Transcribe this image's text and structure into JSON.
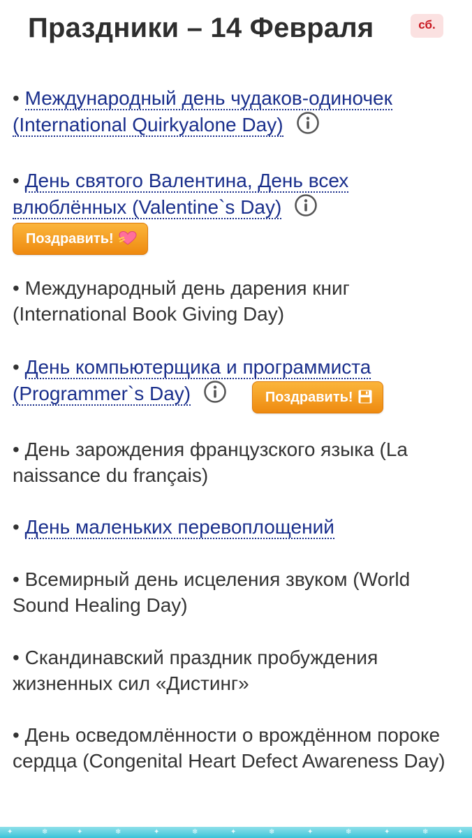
{
  "header": {
    "title": "Праздники – 14 Февраля",
    "day_badge": "сб."
  },
  "holidays": [
    {
      "bullet": "•",
      "title": "Международный день чудаков-одиночек (International Quirkyalone Day)",
      "is_link": true,
      "has_info": true,
      "button": null
    },
    {
      "bullet": "•",
      "title": "День святого Валентина, День всех влюблённых (Valentine`s Day)",
      "is_link": true,
      "has_info": true,
      "button": {
        "label": "Поздравить!",
        "icon": "heart-icon"
      }
    },
    {
      "bullet": "•",
      "title": "Международный день дарения книг (International Book Giving Day)",
      "is_link": false,
      "has_info": false,
      "button": null
    },
    {
      "bullet": "•",
      "title": "День компьютерщика и программиста (Programmer`s Day)",
      "is_link": true,
      "has_info": true,
      "button": {
        "label": "Поздравить!",
        "icon": "floppy-disk-icon"
      }
    },
    {
      "bullet": "•",
      "title": "День зарождения французского языка (La naissance du français)",
      "is_link": false,
      "has_info": false,
      "button": null
    },
    {
      "bullet": "•",
      "title": "День маленьких перевоплощений",
      "is_link": true,
      "has_info": false,
      "button": null
    },
    {
      "bullet": "•",
      "title": "Всемирный день исцеления звуком (World Sound Healing Day)",
      "is_link": false,
      "has_info": false,
      "button": null
    },
    {
      "bullet": "•",
      "title": "Скандинавский праздник пробуждения жизненных сил «Дистинг»",
      "is_link": false,
      "has_info": false,
      "button": null
    },
    {
      "bullet": "•",
      "title": "День осведомлённости о врождённом пороке сердца (Congenital Heart Defect Awareness Day)",
      "is_link": false,
      "has_info": false,
      "button": null
    }
  ],
  "colors": {
    "link": "#1a2f8c",
    "text": "#333333",
    "button": "#f29a1e",
    "badge_bg": "#fbe1e1",
    "badge_text": "#c8141e"
  }
}
